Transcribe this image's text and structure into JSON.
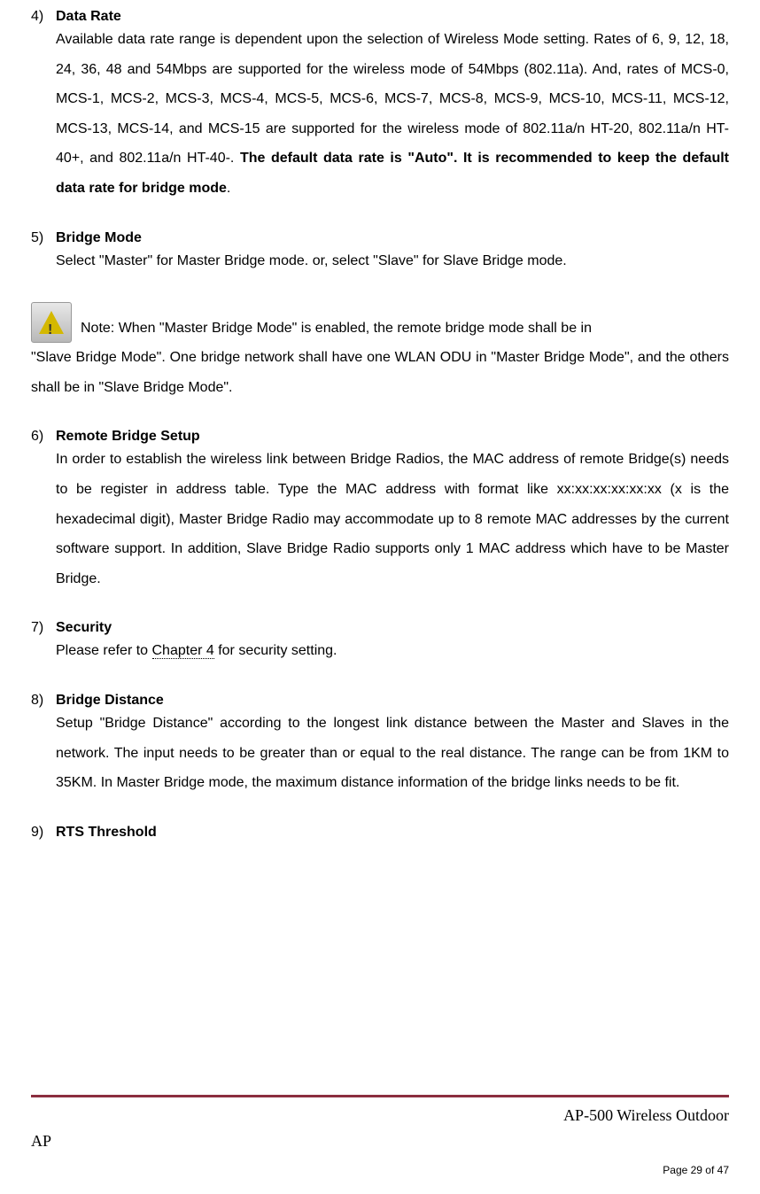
{
  "sections": {
    "item4": {
      "number": "4)",
      "heading": "Data Rate",
      "body_part1": "Available data rate range is dependent upon the selection of Wireless Mode setting. Rates of 6, 9, 12, 18, 24, 36, 48 and 54Mbps are supported for the wireless mode of 54Mbps (802.11a). And, rates of MCS-0, MCS-1, MCS-2, MCS-3, MCS-4, MCS-5, MCS-6, MCS-7, MCS-8, MCS-9, MCS-10, MCS-11, MCS-12, MCS-13, MCS-14, and MCS-15 are supported for the wireless mode of 802.11a/n HT-20, 802.11a/n HT-40+, and 802.11a/n HT-40-. ",
      "body_bold": "The default data rate is \"Auto\".  It is recommended to keep the default data rate for bridge mode",
      "body_period": "."
    },
    "item5": {
      "number": "5)",
      "heading": "Bridge Mode",
      "body": "Select \"Master\" for Master Bridge mode. or, select \"Slave\" for Slave Bridge mode."
    },
    "note": {
      "line1": " Note: When \"Master Bridge Mode\" is enabled, the remote bridge mode shall be in",
      "line2": "\"Slave Bridge Mode\".  One bridge network shall have one WLAN ODU in \"Master Bridge Mode\", and the others shall be in \"Slave Bridge Mode\"."
    },
    "item6": {
      "number": "6)",
      "heading": "Remote Bridge Setup",
      "body": "In order to establish the wireless link between Bridge Radios, the MAC address of remote Bridge(s) needs to be register in address table. Type the MAC address with format like xx:xx:xx:xx:xx:xx (x is the hexadecimal digit), Master Bridge Radio may accommodate up to 8 remote MAC addresses by the current software support. In addition, Slave Bridge Radio supports only 1 MAC address which have to be Master Bridge."
    },
    "item7": {
      "number": "7)",
      "heading": "Security",
      "body_part1": "Please refer to ",
      "body_link": "Chapter 4",
      "body_part2": " for security setting."
    },
    "item8": {
      "number": "8)",
      "heading": "Bridge Distance",
      "body": "Setup \"Bridge Distance\" according to the longest link distance between the Master and Slaves in the network. The input needs to be greater than or equal to the real distance. The range can be from 1KM to 35KM. In Master Bridge mode, the maximum distance information of the bridge links needs to be fit."
    },
    "item9": {
      "number": "9)",
      "heading": "RTS Threshold"
    }
  },
  "footer": {
    "product": "AP-500   Wireless  Outdoor",
    "ap": "AP",
    "page": "Page 29 of 47"
  }
}
